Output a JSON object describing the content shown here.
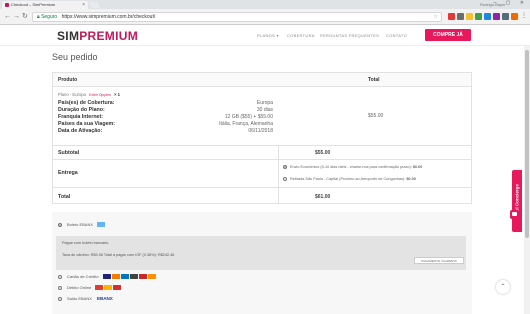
{
  "browser": {
    "tab_title": "Checkout – SimPremium",
    "tab_close": "×",
    "user": "Rodrigo Bayer",
    "window_controls": "– ▢ ✕",
    "nav_back": "←",
    "nav_forward": "→",
    "nav_reload": "↻",
    "secure_label": "Seguro",
    "url": "https://www.simpremium.com.br/checkout/",
    "menu": "⋮"
  },
  "site": {
    "logo_left": "SIM",
    "logo_right": "PREMIUM",
    "nav": [
      "PLANOS ▾",
      "COBERTURA",
      "PERGUNTAS FREQUENTES",
      "CONTATO"
    ],
    "cta": "COMPRE JÁ"
  },
  "order": {
    "heading": "Seu pedido",
    "col_product": "Produto",
    "col_total": "Total",
    "product_name": "Plano - Europa",
    "product_options_link": "Exibir Opções",
    "product_qty": "× 1",
    "details": [
      {
        "label": "País(es) de Cobertura:",
        "value": "Europa"
      },
      {
        "label": "Duração do Plano:",
        "value": "30 dias"
      },
      {
        "label": "Franquia Internet:",
        "value": "12 GB ($55) + $55.00"
      },
      {
        "label": "Países da sua Viagem:",
        "value": "Itália, França, Alemanha"
      },
      {
        "label": "Data de Ativação:",
        "value": "06/11/2018"
      }
    ],
    "line_total": "$55.00",
    "subtotal_label": "Subtotal",
    "subtotal_value": "$55.00",
    "shipping_label": "Entrega",
    "shipping_options": [
      {
        "text": "Envio Econômico (5-10 dias úteis - chame-nos para confirmação prazo):",
        "price": "$6.00",
        "selected": true
      },
      {
        "text": "Retirada São Paulo - Capital (Próximo ao Aeroporto de Congonhas):",
        "price": "$0.00",
        "selected": false
      }
    ],
    "total_label": "Total",
    "total_value": "$61.00"
  },
  "payment": {
    "options": [
      {
        "label": "Boleto EBANX",
        "selected": true
      },
      {
        "label": "Cartão de Crédito",
        "selected": false
      },
      {
        "label": "Débito Online",
        "selected": false
      },
      {
        "label": "Saldo EBANX",
        "selected": false
      }
    ],
    "boleto_info_1": "Pague com boleto bancário.",
    "boleto_info_2": "Taxa de câmbio: R$3.96 Total a pagar com IOF (0.38%): R$242.46",
    "badge": "PAGAMENTO VIA EBANX",
    "ebanx_logo": "EBANX"
  },
  "widgets": {
    "fidel_tab": "Fidel Concierge",
    "back_to_top": "⌃"
  },
  "colors": {
    "brand": "#e8185c",
    "secure": "#0b8043"
  }
}
